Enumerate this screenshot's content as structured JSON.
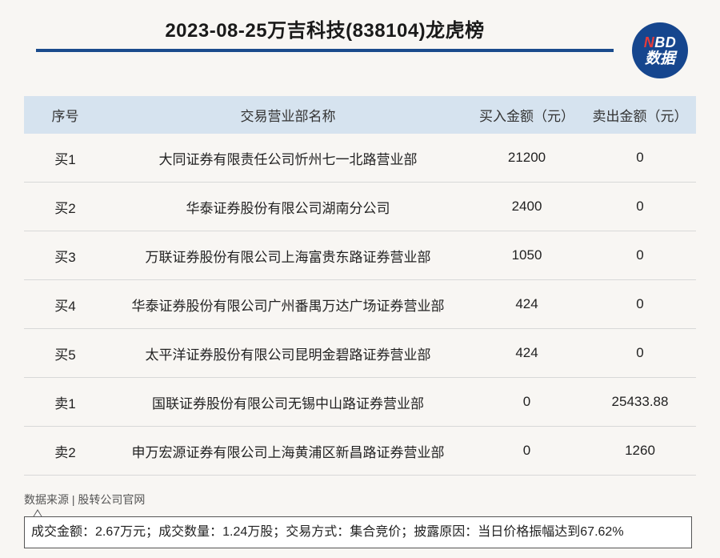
{
  "title": "2023-08-25万吉科技(838104)龙虎榜",
  "logo": {
    "line1_n": "N",
    "line1_rest": "BD",
    "line2": "数据"
  },
  "table": {
    "headers": [
      "序号",
      "交易营业部名称",
      "买入金额（元）",
      "卖出金额（元）"
    ],
    "rows": [
      [
        "买1",
        "大同证券有限责任公司忻州七一北路营业部",
        "21200",
        "0"
      ],
      [
        "买2",
        "华泰证券股份有限公司湖南分公司",
        "2400",
        "0"
      ],
      [
        "买3",
        "万联证券股份有限公司上海富贵东路证券营业部",
        "1050",
        "0"
      ],
      [
        "买4",
        "华泰证券股份有限公司广州番禺万达广场证券营业部",
        "424",
        "0"
      ],
      [
        "买5",
        "太平洋证券股份有限公司昆明金碧路证券营业部",
        "424",
        "0"
      ],
      [
        "卖1",
        "国联证券股份有限公司无锡中山路证券营业部",
        "0",
        "25433.88"
      ],
      [
        "卖2",
        "申万宏源证券有限公司上海黄浦区新昌路证券营业部",
        "0",
        "1260"
      ]
    ]
  },
  "source": "数据来源 | 股转公司官网",
  "note": "成交金额：2.67万元；成交数量：1.24万股；交易方式：集合竞价；披露原因：当日价格振幅达到67.62%"
}
